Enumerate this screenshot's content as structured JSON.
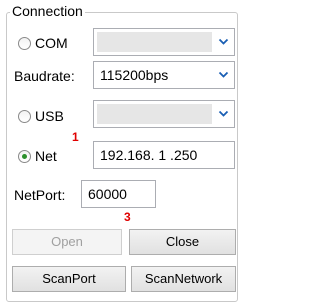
{
  "groupbox": {
    "title": "Connection"
  },
  "com": {
    "label": "COM",
    "selected": false,
    "port_value": "",
    "enabled": false
  },
  "baudrate": {
    "label": "Baudrate:",
    "value": "115200bps",
    "enabled": true
  },
  "usb": {
    "label": "USB",
    "selected": false,
    "device_value": "",
    "enabled": false
  },
  "net": {
    "label": "Net",
    "selected": true,
    "ip_value": "192.168. 1 .250"
  },
  "netport": {
    "label": "NetPort:",
    "value": "60000"
  },
  "buttons": {
    "open": {
      "label": "Open",
      "enabled": false
    },
    "close": {
      "label": "Close",
      "enabled": true
    },
    "scan_port": {
      "label": "ScanPort",
      "enabled": true
    },
    "scan_network": {
      "label": "ScanNetwork",
      "enabled": true
    }
  },
  "annotations": {
    "marker_1": "1",
    "marker_3": "3"
  },
  "colors": {
    "annotation_red": "#e00000",
    "radio_checked_dot": "#2a8f2a",
    "dropdown_arrow": "#1a5fb4",
    "disabled_text": "#a0a0a0"
  },
  "icons": {
    "dropdown_arrow": "chevron-down-icon"
  }
}
